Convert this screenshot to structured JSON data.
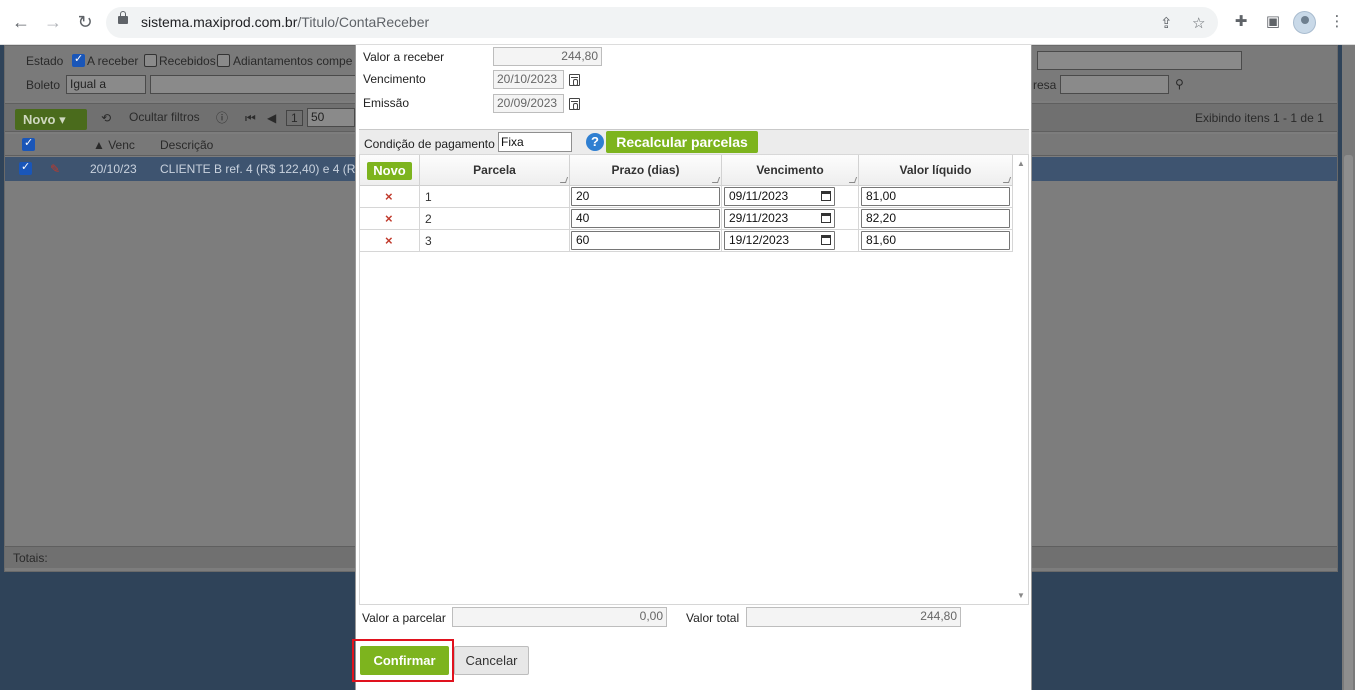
{
  "browser": {
    "url_host": "sistema.maxiprod.com.br",
    "url_path": "/Titulo/ContaReceber"
  },
  "background": {
    "estado_label": "Estado",
    "filter_a_receber": "A receber",
    "filter_recebidos": "Recebidos",
    "filter_adiantamentos": "Adiantamentos compe",
    "boleto_label": "Boleto",
    "boleto_value": "Igual a",
    "empresa_label_partial": "resa",
    "novo_label": "Novo",
    "ocultar_filtros": "Ocultar filtros",
    "page_number": "1",
    "page_size": "50",
    "exibindo": "Exibindo itens 1 - 1 de 1",
    "col_venc": "Venc",
    "col_descricao": "Descrição",
    "row_venc": "20/10/23",
    "row_descricao": "CLIENTE B ref. 4 (R$ 122,40) e 4 (R",
    "totais": "Totais:"
  },
  "modal": {
    "valor_receber_label": "Valor a receber",
    "valor_receber_value": "244,80",
    "vencimento_label": "Vencimento",
    "vencimento_value": "20/10/2023",
    "emissao_label": "Emissão",
    "emissao_value": "20/09/2023",
    "condicao_label": "Condição de pagamento",
    "condicao_value": "Fixa",
    "recalcular_label": "Recalcular parcelas",
    "grid": {
      "novo_label": "Novo",
      "headers": [
        "Parcela",
        "Prazo (dias)",
        "Vencimento",
        "Valor líquido"
      ],
      "rows": [
        {
          "parcela": "1",
          "prazo": "20",
          "vencimento": "09/11/2023",
          "valor": "81,00"
        },
        {
          "parcela": "2",
          "prazo": "40",
          "vencimento": "29/11/2023",
          "valor": "82,20"
        },
        {
          "parcela": "3",
          "prazo": "60",
          "vencimento": "19/12/2023",
          "valor": "81,60"
        }
      ]
    },
    "valor_parcelar_label": "Valor a parcelar",
    "valor_parcelar_value": "0,00",
    "valor_total_label": "Valor total",
    "valor_total_value": "244,80",
    "confirmar_label": "Confirmar",
    "cancelar_label": "Cancelar"
  },
  "colors": {
    "accent_green": "#7db41e",
    "highlight_red": "#e0121e"
  }
}
